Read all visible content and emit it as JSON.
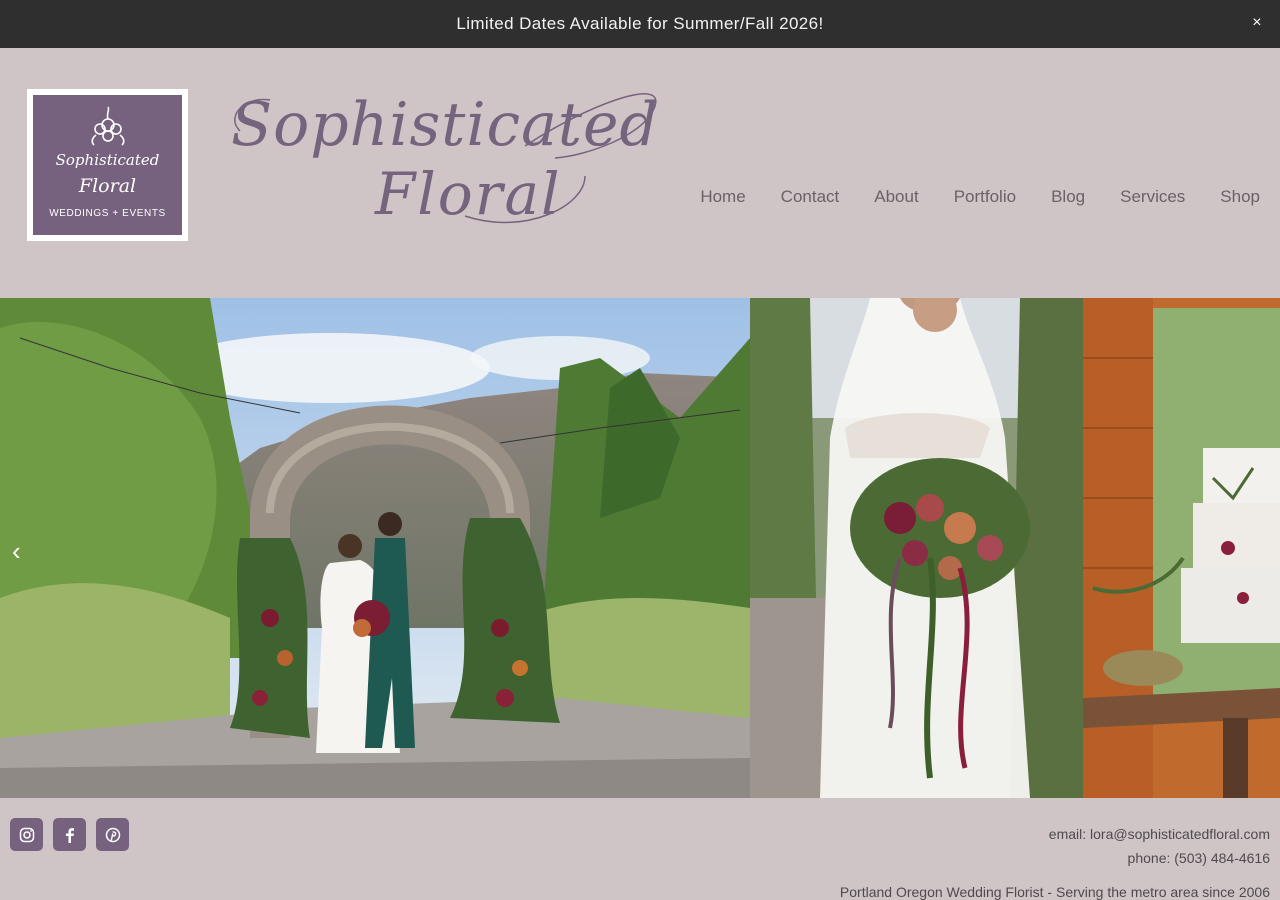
{
  "announcement": {
    "text": "Limited Dates Available for Summer/Fall 2026!",
    "close": "×"
  },
  "logo": {
    "line1": "Sophisticated",
    "line2": "Floral",
    "subtitle": "WEDDINGS + EVENTS"
  },
  "wordmark": {
    "line1": "Sophisticated",
    "line2": "Floral"
  },
  "nav": [
    {
      "label": "Home"
    },
    {
      "label": "Contact"
    },
    {
      "label": "About"
    },
    {
      "label": "Portfolio"
    },
    {
      "label": "Blog"
    },
    {
      "label": "Services"
    },
    {
      "label": "Shop"
    }
  ],
  "hero": {
    "prev_arrow": "‹"
  },
  "footer": {
    "socials": [
      "instagram-icon",
      "facebook-icon",
      "pinterest-icon"
    ],
    "email": "email: lora@sophisticatedfloral.com",
    "phone": "phone: (503) 484-4616",
    "tagline": "Portland Oregon Wedding Florist - Serving the metro area since 2006"
  },
  "colors": {
    "background": "#cfc5c6",
    "brand_purple": "#76617f",
    "announce_bg": "#2f2f2f"
  }
}
